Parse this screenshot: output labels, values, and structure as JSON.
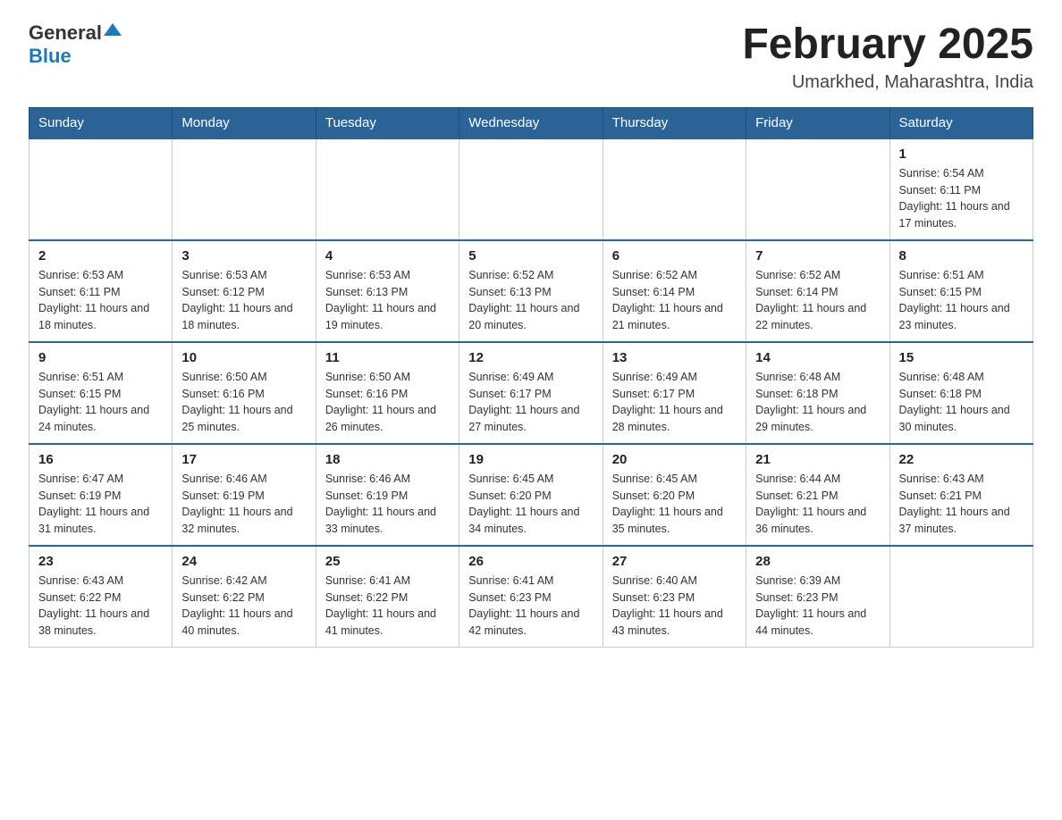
{
  "header": {
    "logo_general": "General",
    "logo_blue": "Blue",
    "title": "February 2025",
    "subtitle": "Umarkhed, Maharashtra, India"
  },
  "weekdays": [
    "Sunday",
    "Monday",
    "Tuesday",
    "Wednesday",
    "Thursday",
    "Friday",
    "Saturday"
  ],
  "weeks": [
    [
      {
        "day": "",
        "info": ""
      },
      {
        "day": "",
        "info": ""
      },
      {
        "day": "",
        "info": ""
      },
      {
        "day": "",
        "info": ""
      },
      {
        "day": "",
        "info": ""
      },
      {
        "day": "",
        "info": ""
      },
      {
        "day": "1",
        "info": "Sunrise: 6:54 AM\nSunset: 6:11 PM\nDaylight: 11 hours and 17 minutes."
      }
    ],
    [
      {
        "day": "2",
        "info": "Sunrise: 6:53 AM\nSunset: 6:11 PM\nDaylight: 11 hours and 18 minutes."
      },
      {
        "day": "3",
        "info": "Sunrise: 6:53 AM\nSunset: 6:12 PM\nDaylight: 11 hours and 18 minutes."
      },
      {
        "day": "4",
        "info": "Sunrise: 6:53 AM\nSunset: 6:13 PM\nDaylight: 11 hours and 19 minutes."
      },
      {
        "day": "5",
        "info": "Sunrise: 6:52 AM\nSunset: 6:13 PM\nDaylight: 11 hours and 20 minutes."
      },
      {
        "day": "6",
        "info": "Sunrise: 6:52 AM\nSunset: 6:14 PM\nDaylight: 11 hours and 21 minutes."
      },
      {
        "day": "7",
        "info": "Sunrise: 6:52 AM\nSunset: 6:14 PM\nDaylight: 11 hours and 22 minutes."
      },
      {
        "day": "8",
        "info": "Sunrise: 6:51 AM\nSunset: 6:15 PM\nDaylight: 11 hours and 23 minutes."
      }
    ],
    [
      {
        "day": "9",
        "info": "Sunrise: 6:51 AM\nSunset: 6:15 PM\nDaylight: 11 hours and 24 minutes."
      },
      {
        "day": "10",
        "info": "Sunrise: 6:50 AM\nSunset: 6:16 PM\nDaylight: 11 hours and 25 minutes."
      },
      {
        "day": "11",
        "info": "Sunrise: 6:50 AM\nSunset: 6:16 PM\nDaylight: 11 hours and 26 minutes."
      },
      {
        "day": "12",
        "info": "Sunrise: 6:49 AM\nSunset: 6:17 PM\nDaylight: 11 hours and 27 minutes."
      },
      {
        "day": "13",
        "info": "Sunrise: 6:49 AM\nSunset: 6:17 PM\nDaylight: 11 hours and 28 minutes."
      },
      {
        "day": "14",
        "info": "Sunrise: 6:48 AM\nSunset: 6:18 PM\nDaylight: 11 hours and 29 minutes."
      },
      {
        "day": "15",
        "info": "Sunrise: 6:48 AM\nSunset: 6:18 PM\nDaylight: 11 hours and 30 minutes."
      }
    ],
    [
      {
        "day": "16",
        "info": "Sunrise: 6:47 AM\nSunset: 6:19 PM\nDaylight: 11 hours and 31 minutes."
      },
      {
        "day": "17",
        "info": "Sunrise: 6:46 AM\nSunset: 6:19 PM\nDaylight: 11 hours and 32 minutes."
      },
      {
        "day": "18",
        "info": "Sunrise: 6:46 AM\nSunset: 6:19 PM\nDaylight: 11 hours and 33 minutes."
      },
      {
        "day": "19",
        "info": "Sunrise: 6:45 AM\nSunset: 6:20 PM\nDaylight: 11 hours and 34 minutes."
      },
      {
        "day": "20",
        "info": "Sunrise: 6:45 AM\nSunset: 6:20 PM\nDaylight: 11 hours and 35 minutes."
      },
      {
        "day": "21",
        "info": "Sunrise: 6:44 AM\nSunset: 6:21 PM\nDaylight: 11 hours and 36 minutes."
      },
      {
        "day": "22",
        "info": "Sunrise: 6:43 AM\nSunset: 6:21 PM\nDaylight: 11 hours and 37 minutes."
      }
    ],
    [
      {
        "day": "23",
        "info": "Sunrise: 6:43 AM\nSunset: 6:22 PM\nDaylight: 11 hours and 38 minutes."
      },
      {
        "day": "24",
        "info": "Sunrise: 6:42 AM\nSunset: 6:22 PM\nDaylight: 11 hours and 40 minutes."
      },
      {
        "day": "25",
        "info": "Sunrise: 6:41 AM\nSunset: 6:22 PM\nDaylight: 11 hours and 41 minutes."
      },
      {
        "day": "26",
        "info": "Sunrise: 6:41 AM\nSunset: 6:23 PM\nDaylight: 11 hours and 42 minutes."
      },
      {
        "day": "27",
        "info": "Sunrise: 6:40 AM\nSunset: 6:23 PM\nDaylight: 11 hours and 43 minutes."
      },
      {
        "day": "28",
        "info": "Sunrise: 6:39 AM\nSunset: 6:23 PM\nDaylight: 11 hours and 44 minutes."
      },
      {
        "day": "",
        "info": ""
      }
    ]
  ]
}
